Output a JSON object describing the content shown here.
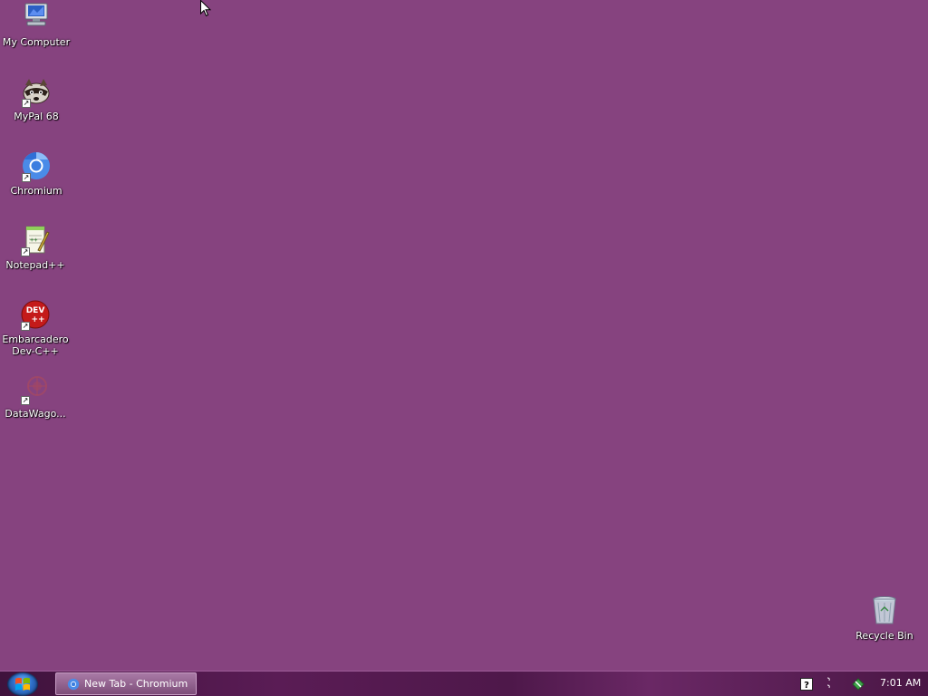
{
  "desktop": {
    "background_color": "#86437f",
    "icons": [
      {
        "label": "My Computer",
        "icon": "computer-icon",
        "shortcut": false
      },
      {
        "label": "MyPal 68",
        "icon": "raccoon-icon",
        "shortcut": true
      },
      {
        "label": "Chromium",
        "icon": "chromium-icon",
        "shortcut": true
      },
      {
        "label": "Notepad++",
        "icon": "notepad-plus-plus-icon",
        "shortcut": true
      },
      {
        "label": "Embarcadero\nDev-C++",
        "icon": "devcpp-icon",
        "shortcut": true,
        "icon_text": "DEV\n++"
      },
      {
        "label": "DataWago...",
        "icon": "datawagon-icon",
        "shortcut": true
      }
    ],
    "recycle_bin": {
      "label": "Recycle Bin",
      "icon": "recycle-bin-icon"
    }
  },
  "taskbar": {
    "start": {
      "icon": "windows-logo-icon"
    },
    "tasks": [
      {
        "label": "New Tab - Chromium",
        "icon": "chromium-icon"
      }
    ],
    "tray": {
      "icons": [
        "help-icon",
        "network-icon",
        "security-icon"
      ],
      "clock": "7:01 AM"
    }
  }
}
